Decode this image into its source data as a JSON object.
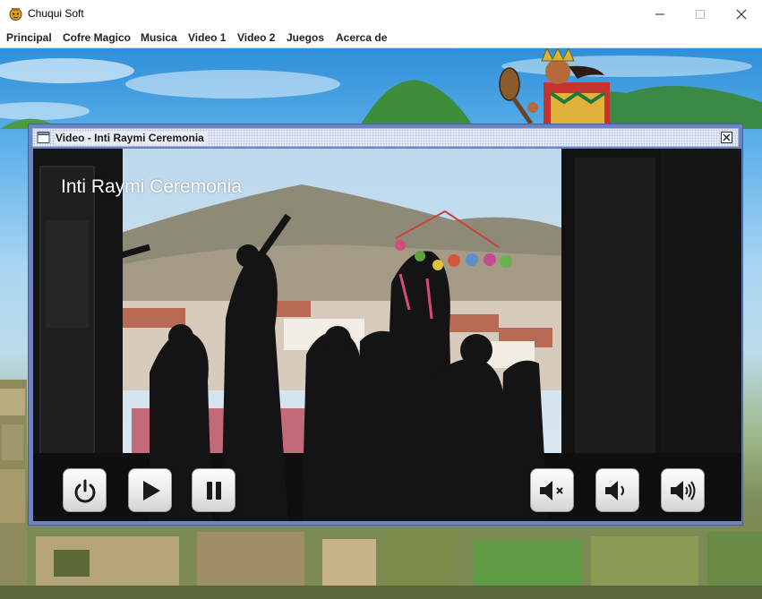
{
  "window": {
    "title": "Chuqui Soft",
    "app_icon": "incan-mask-icon",
    "controls": [
      "minimize-icon",
      "maximize-icon",
      "close-icon"
    ]
  },
  "menu": {
    "items": [
      {
        "label": "Principal"
      },
      {
        "label": "Cofre Magico"
      },
      {
        "label": "Musica"
      },
      {
        "label": "Video 1"
      },
      {
        "label": "Video 2"
      },
      {
        "label": "Juegos"
      },
      {
        "label": "Acerca de"
      }
    ]
  },
  "internal_frame": {
    "title": "Video - Inti Raymi Ceremonia",
    "icon": "window-icon",
    "close_icon": "close-icon"
  },
  "video": {
    "overlay_text": "Inti Raymi Ceremonia",
    "controls": [
      {
        "name": "power-button",
        "icon": "power-icon"
      },
      {
        "name": "play-button",
        "icon": "play-icon"
      },
      {
        "name": "pause-button",
        "icon": "pause-icon"
      },
      {
        "name": "mute-button",
        "icon": "volume-mute-icon"
      },
      {
        "name": "volume-down-button",
        "icon": "volume-low-icon"
      },
      {
        "name": "volume-up-button",
        "icon": "volume-high-icon"
      }
    ]
  },
  "colors": {
    "frame_border": "#6d84bf",
    "frame_title_bg": "#e7ecf7",
    "sky": "#5eb2ea"
  }
}
